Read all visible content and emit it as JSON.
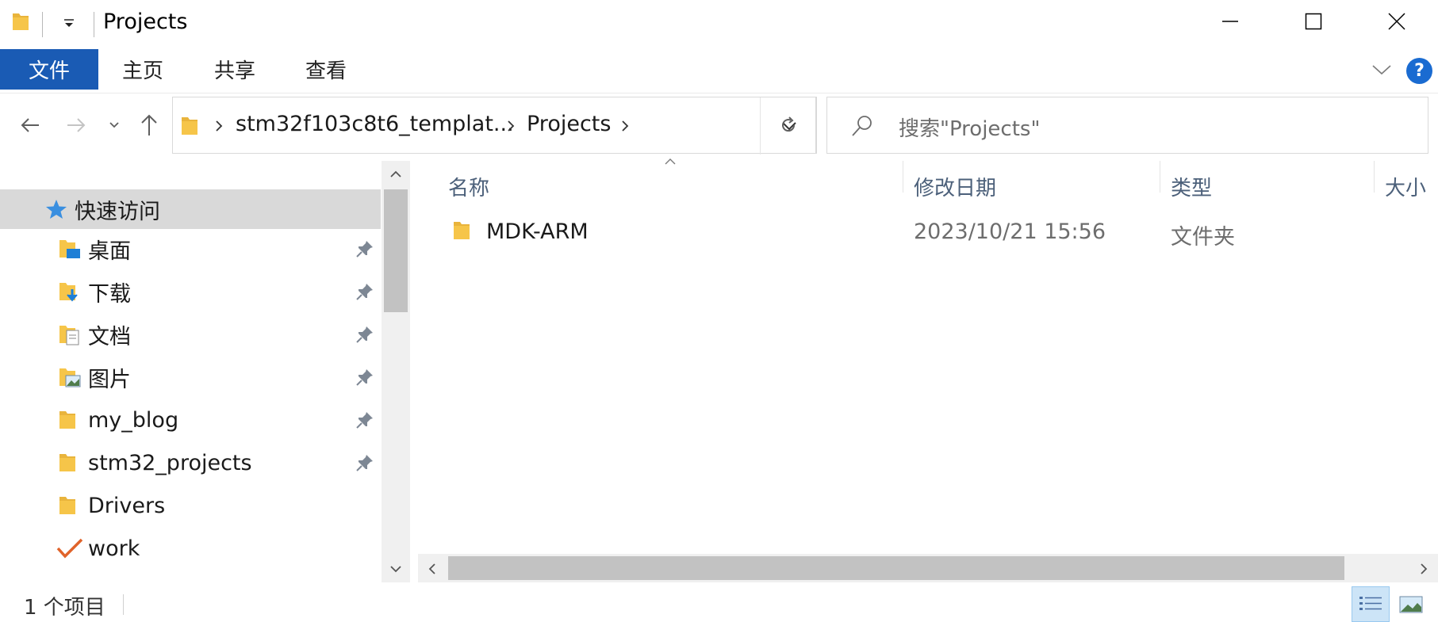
{
  "window": {
    "title": "Projects",
    "minimize_label": "—",
    "maximize_label": "☐",
    "close_label": "✕"
  },
  "ribbon": {
    "tabs": [
      {
        "label": "文件",
        "active": true
      },
      {
        "label": "主页"
      },
      {
        "label": "共享"
      },
      {
        "label": "查看"
      }
    ],
    "help_label": "?"
  },
  "address": {
    "segments": [
      "stm32f103c8t6_templat...",
      "Projects"
    ]
  },
  "search": {
    "placeholder": "搜索\"Projects\""
  },
  "navpane": {
    "items": [
      {
        "label": "快速访问",
        "icon": "star-icon",
        "pinned": false,
        "selected": true
      },
      {
        "label": "桌面",
        "icon": "desktop-folder-icon",
        "pinned": true
      },
      {
        "label": "下载",
        "icon": "downloads-folder-icon",
        "pinned": true
      },
      {
        "label": "文档",
        "icon": "documents-folder-icon",
        "pinned": true
      },
      {
        "label": "图片",
        "icon": "pictures-folder-icon",
        "pinned": true
      },
      {
        "label": "my_blog",
        "icon": "folder-icon",
        "pinned": true
      },
      {
        "label": "stm32_projects",
        "icon": "folder-icon",
        "pinned": true
      },
      {
        "label": "Drivers",
        "icon": "folder-icon",
        "pinned": false
      },
      {
        "label": "work",
        "icon": "checkmark-icon",
        "pinned": false
      }
    ]
  },
  "content": {
    "columns": [
      "名称",
      "修改日期",
      "类型",
      "大小"
    ],
    "rows": [
      {
        "name": "MDK-ARM",
        "modified": "2023/10/21 15:56",
        "type": "文件夹",
        "size": ""
      }
    ]
  },
  "status": {
    "item_count": "1 个项目"
  },
  "colors": {
    "accent": "#1a5bb4",
    "folder": "#f6c549",
    "selection": "#d9d9d9",
    "header_text": "#4c607a"
  }
}
